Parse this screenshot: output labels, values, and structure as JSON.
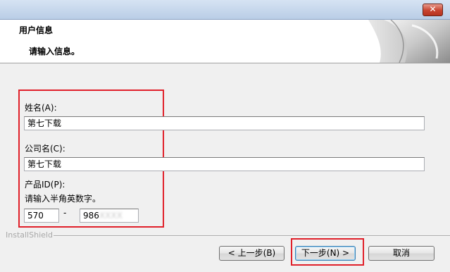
{
  "header": {
    "title": "用户信息",
    "subtitle": "请输入信息。"
  },
  "form": {
    "name_label": "姓名(A):",
    "name_value": "第七下载",
    "company_label": "公司名(C):",
    "company_value": "第七下载",
    "product_id_label": "产品ID(P):",
    "product_id_hint": "请输入半角英数字。",
    "product_id_part1": "570",
    "product_id_separator": "-",
    "product_id_part2_visible": "986",
    "product_id_part2_blurred": "XXXX"
  },
  "footer": {
    "brand": "InstallShield",
    "back_label": "< 上一步(B)",
    "next_label": "下一步(N) >",
    "cancel_label": "取消"
  },
  "colors": {
    "highlight": "#e0202a",
    "titlebar": "#c7d8ee",
    "dialog_bg": "#f0f0f0",
    "header_bg": "#ffffff"
  },
  "icons": {
    "close": "close-icon (×)"
  }
}
